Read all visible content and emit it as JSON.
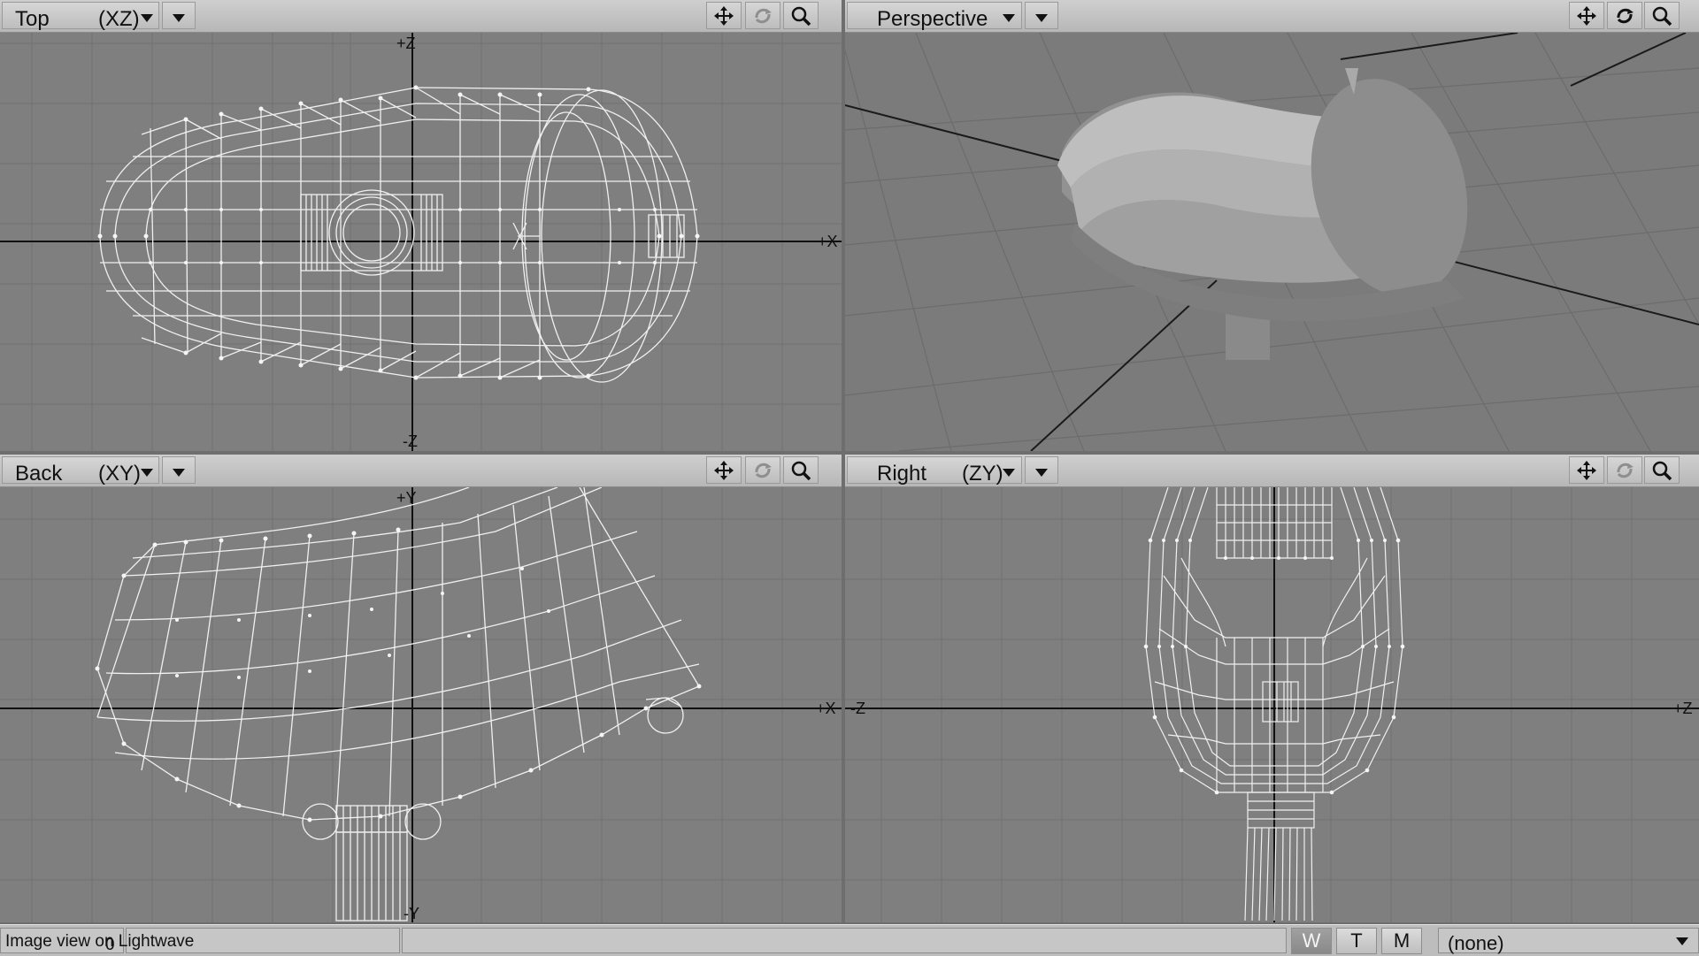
{
  "viewports": {
    "top": {
      "name": "Top",
      "axes": "(XZ)"
    },
    "perspective": {
      "name": "Perspective"
    },
    "back": {
      "name": "Back",
      "axes": "(XY)"
    },
    "right": {
      "name": "Right",
      "axes": "(ZY)"
    }
  },
  "axis_labels": {
    "top_up": "+Z",
    "top_right": "+X",
    "top_bottom": "-Z",
    "back_up": "+Y",
    "back_right": "+X",
    "back_bottom": "-Y",
    "right_left": "-Z",
    "right_right": "+Z"
  },
  "status": {
    "left_value": "0",
    "message": "Image view on Lightwave",
    "modes": [
      "W",
      "T",
      "M"
    ],
    "active_mode": "W",
    "selection": "(none)"
  },
  "icons": [
    "move-icon",
    "rotate-icon",
    "zoom-icon",
    "dropdown-arrow-icon"
  ],
  "colors": {
    "viewport_bg": "#7f7f7f",
    "wireframe": "#f2f2f2",
    "grid": "#6f6f6f",
    "toolbar": "#c4c4c4"
  }
}
